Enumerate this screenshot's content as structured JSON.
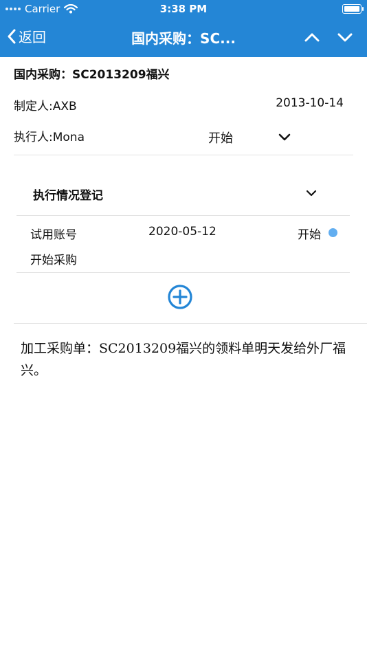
{
  "status_bar": {
    "carrier": "Carrier",
    "time": "3:38 PM"
  },
  "nav": {
    "back_label": "返回",
    "title": "国内采购：SC..."
  },
  "document": {
    "title": "国内采购：SC2013209福兴",
    "maker": "制定人:AXB",
    "date": "2013-10-14",
    "executor": "执行人:Mona",
    "status": "开始"
  },
  "section": {
    "title": "执行情况登记",
    "entries": [
      {
        "account": "试用账号",
        "date": "2020-05-12",
        "status": "开始",
        "note": "开始采购",
        "status_color": "#62aef0"
      }
    ]
  },
  "remark": "加工采购单：SC2013209福兴的领料单明天发给外厂福兴。",
  "colors": {
    "accent": "#2486d6"
  },
  "icons": {
    "back": "chevron-left-icon",
    "up": "chevron-up-icon",
    "down": "chevron-down-icon",
    "add": "plus-circle-icon",
    "wifi": "wifi-icon",
    "battery": "battery-icon"
  }
}
